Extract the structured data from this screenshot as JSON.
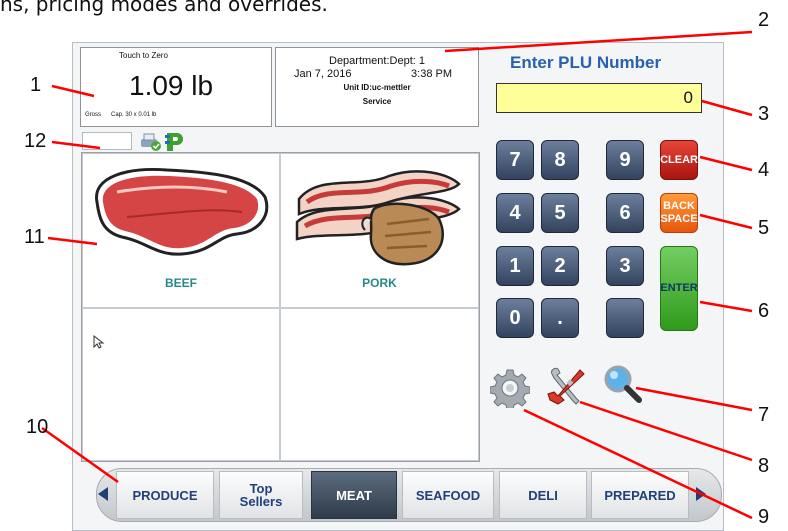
{
  "caption": "ns, pricing modes and overrides.",
  "weight": {
    "touch_to_zero": "Touch to Zero",
    "value": "1.09 lb",
    "gross": "Gross",
    "capacity": "Cap. 30 x 0.01 lb"
  },
  "info": {
    "department": "Department:Dept: 1",
    "date": "Jan 7, 2016",
    "time": "3:38 PM",
    "unit": "Unit ID:uc-mettler",
    "mode": "Service"
  },
  "plu": {
    "title": "Enter PLU Number",
    "value": "0"
  },
  "products": [
    {
      "label": "BEEF",
      "icon": "steak-icon"
    },
    {
      "label": "PORK",
      "icon": "bacon-chop-icon"
    }
  ],
  "keypad": {
    "keys": [
      "7",
      "8",
      "9",
      "4",
      "5",
      "6",
      "1",
      "2",
      "3",
      "0",
      "."
    ],
    "clear": "CLEAR",
    "back": [
      "BACK",
      "SPACE"
    ],
    "enter": "ENTER"
  },
  "tools": [
    "settings-gear-icon",
    "tools-icon",
    "search-magnifier-icon"
  ],
  "tabs": {
    "items": [
      "PRODUCE",
      "Top\nSellers",
      "MEAT",
      "SEAFOOD",
      "DELI",
      "PREPARED"
    ],
    "active": "MEAT"
  },
  "callouts": [
    "1",
    "2",
    "3",
    "4",
    "5",
    "6",
    "7",
    "8",
    "9",
    "10",
    "11",
    "12"
  ],
  "colors": {
    "plu_title": "#2a60b0",
    "plu_field": "#ffff9a",
    "product_label": "#268a88",
    "clear": "#c41f14",
    "backspace": "#f0700f",
    "enter": "#46b330",
    "tab_text": "#21407a"
  }
}
